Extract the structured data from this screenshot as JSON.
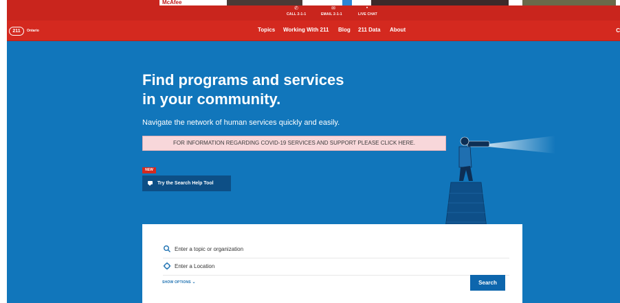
{
  "browser_overlay": {
    "ad_label": "McAfee"
  },
  "utility_bar": {
    "items": [
      {
        "label": "CALL 2-1-1",
        "icon": "phone-icon"
      },
      {
        "label": "EMAIL 2-1-1",
        "icon": "mail-icon"
      },
      {
        "label": "LIVE CHAT",
        "icon": "chat-icon"
      }
    ]
  },
  "nav": {
    "logo_text": "211",
    "logo_sub": "Ontario",
    "items": [
      {
        "label": "Topics"
      },
      {
        "label": "Working With 211"
      },
      {
        "label": "Blog"
      },
      {
        "label": "211 Data"
      },
      {
        "label": "About"
      }
    ],
    "edge_char": "C"
  },
  "hero": {
    "title_line1": "Find programs and services",
    "title_line2": "in your community.",
    "subtitle": "Navigate the network of human services quickly and easily.",
    "covid_notice": "FOR INFORMATION REGARDING COVID-19 SERVICES AND SUPPORT PLEASE CLICK HERE.",
    "new_badge": "NEW",
    "help_button": "Try the Search Help Tool"
  },
  "search": {
    "topic_placeholder": "Enter a topic or organization",
    "location_placeholder": "Enter a Location",
    "show_options": "SHOW OPTIONS",
    "search_button": "Search"
  },
  "colors": {
    "brand_red": "#d4291f",
    "hero_blue": "#1176bb",
    "button_blue": "#0d66ad",
    "covid_bg": "#f8d7da"
  }
}
